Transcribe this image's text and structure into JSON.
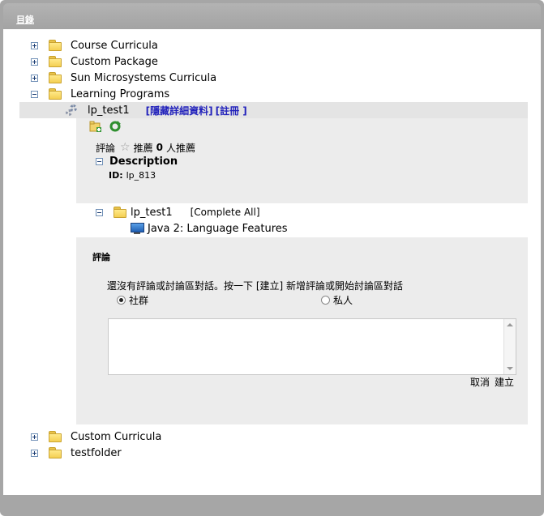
{
  "header": {
    "title": "目錄"
  },
  "tree": {
    "top_items": [
      {
        "label": "Course Curricula"
      },
      {
        "label": "Custom Package"
      },
      {
        "label": "Sun Microsystems Curricula"
      },
      {
        "label": "Learning Programs"
      }
    ],
    "bottom_items": [
      {
        "label": "Custom Curricula"
      },
      {
        "label": "testfolder"
      }
    ]
  },
  "program": {
    "name": "lp_test1",
    "hide_details_link": "[隱藏詳細資料]",
    "register_link": "[註冊 ]",
    "comments_label": "評論",
    "recommend_label": "推薦",
    "recommend_count": "0",
    "recommend_suffix": "人推薦",
    "description_title": "Description",
    "id_label": "ID:",
    "id_value": "lp_813",
    "sub_folder": "lp_test1",
    "complete_all": "[Complete All]",
    "course": "Java 2: Language Features"
  },
  "discussion": {
    "title": "評論",
    "message": "還沒有評論或討論區對話。按一下 [建立] 新增評論或開始討論區對話",
    "option_community": "社群",
    "option_private": "私人",
    "selected": "社群",
    "textarea_value": "",
    "cancel_label": "取消",
    "create_label": "建立"
  },
  "colors": {
    "frame": "#a6a6a6",
    "panel": "#ececec",
    "link": "#2222bb"
  }
}
